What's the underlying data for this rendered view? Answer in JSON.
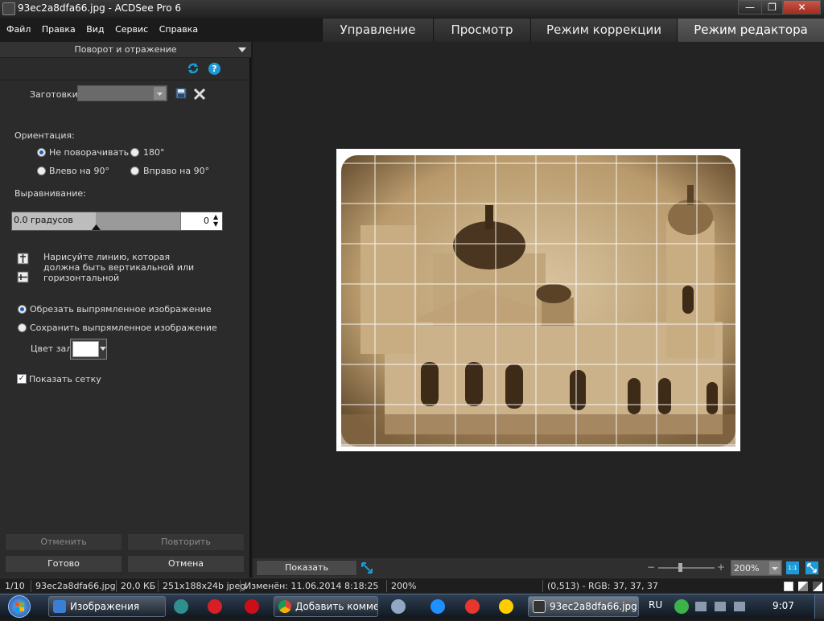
{
  "window": {
    "title": "93ec2a8dfa66.jpg - ACDSee Pro 6",
    "minimize": "—",
    "maximize": "❐",
    "close": "✕"
  },
  "menu": [
    "Файл",
    "Правка",
    "Вид",
    "Сервис",
    "Справка"
  ],
  "modes": [
    "Управление",
    "Просмотр",
    "Режим коррекции",
    "Режим редактора"
  ],
  "panel": {
    "title": "Поворот и отражение",
    "presets_label": "Заготовки",
    "orientation_label": "Ориентация:",
    "orientation": {
      "none": "Не поворачивать",
      "r180": "180°",
      "left90": "Влево на 90°",
      "right90": "Вправо на 90°"
    },
    "alignment_label": "Выравнивание:",
    "slider_text": "0.0 градусов",
    "slider_value": "0",
    "draw_line_hint": "Нарисуйте линию, которая должна быть вертикальной или горизонтальной",
    "crop_option": "Обрезать выпрямленное изображение",
    "keep_option": "Сохранить выпрямленное изображение",
    "fill_color_label": "Цвет зал",
    "fill_color": "#ffffff",
    "show_grid": "Показать сетку",
    "undo": "Отменить",
    "redo": "Повторить",
    "done": "Готово",
    "cancel": "Отмена"
  },
  "viewer": {
    "show_previous": "Показать предыдущее",
    "zoom": "200%"
  },
  "status": {
    "index": "1/10",
    "filename": "93ec2a8dfa66.jpg",
    "filesize": "20,0 КБ",
    "dimensions": "251x188x24b jpeg",
    "modified": "Изменён: 11.06.2014 8:18:25",
    "zoom": "200%",
    "pixel": "(0,513) - RGB: 37, 37, 37"
  },
  "taskbar": {
    "items": [
      "Изображения",
      "Добавить комме...",
      "93ec2a8dfa66.jpg..."
    ],
    "lang": "RU",
    "clock": "9:07"
  },
  "colors": {
    "accent_blue": "#1e9bd7",
    "sepia_light": "#d9c4a0",
    "sepia_dark": "#6b5234"
  }
}
